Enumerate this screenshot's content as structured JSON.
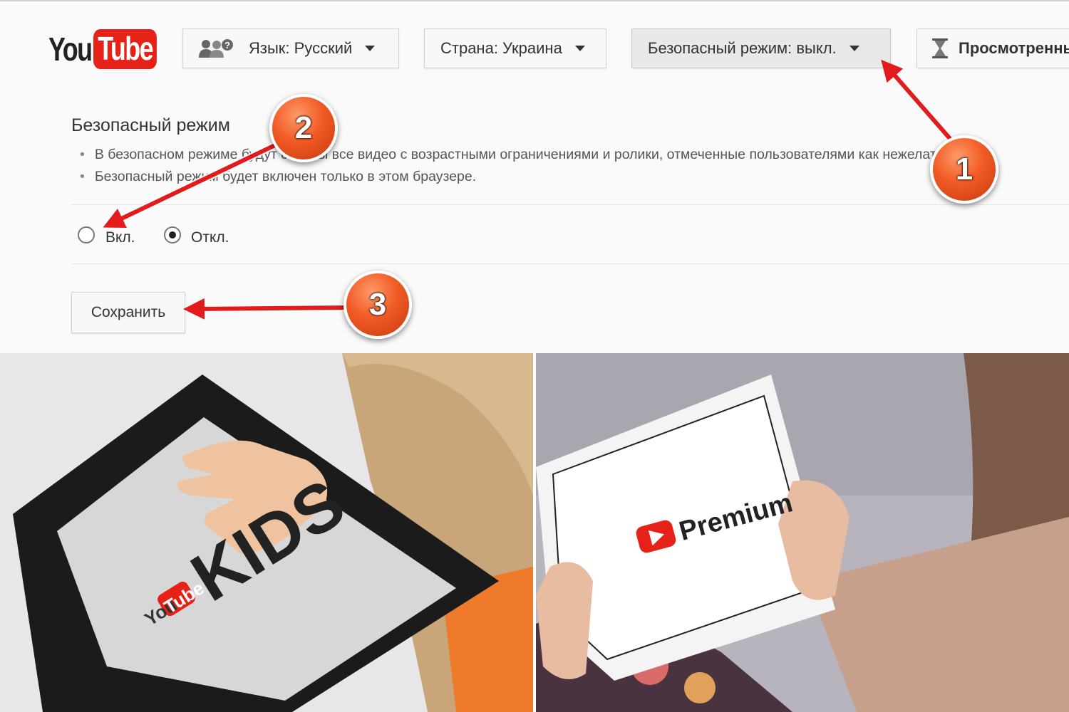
{
  "logo": {
    "you": "You",
    "tube": "Tube"
  },
  "toolbar": {
    "language": "Язык: Русский",
    "country": "Страна: Украина",
    "safe_mode": "Безопасный режим: выкл.",
    "history": "Просмотренны"
  },
  "safe_mode_panel": {
    "title": "Безопасный режим",
    "bullet1": "В безопасном режиме будут скрыты все видео с возрастными ограничениями и ролики, отмеченные пользователями как нежелательные.",
    "bullet2": "Безопасный режим будет включен только в этом браузере.",
    "option_on": "Вкл.",
    "option_off": "Откл.",
    "selected": "Откл.",
    "save_label": "Сохранить"
  },
  "step_badges": [
    "1",
    "2",
    "3"
  ],
  "photo_left": {
    "brand_you": "You",
    "brand_tube": "Tube",
    "product": "KIDS"
  },
  "photo_right": {
    "product": "Premium"
  },
  "colors": {
    "youtube_red": "#e62117",
    "badge_orange": "#f15a24",
    "arrow_red": "#e21b1b"
  }
}
